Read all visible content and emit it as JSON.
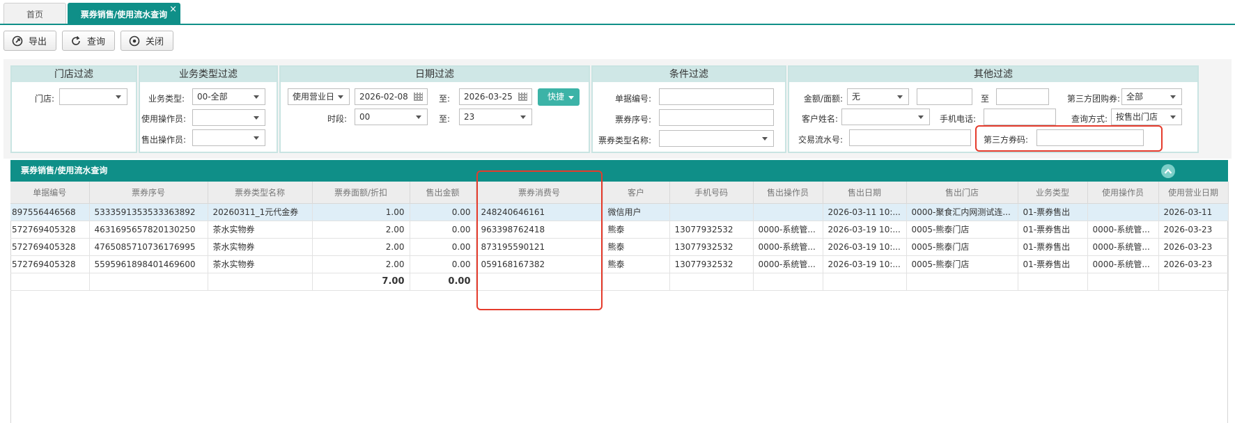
{
  "tabs": {
    "home": "首页",
    "active": "票券销售/使用流水查询",
    "close": "×"
  },
  "toolbar": {
    "export": "导出",
    "query": "查询",
    "close": "关闭"
  },
  "filters": {
    "store": {
      "title": "门店过滤",
      "store_label": "门店:",
      "store_value": ""
    },
    "business": {
      "title": "业务类型过滤",
      "type_label": "业务类型:",
      "type_value": "00-全部",
      "use_operator_label": "使用操作员:",
      "use_operator_value": "",
      "sell_operator_label": "售出操作员:",
      "sell_operator_value": ""
    },
    "date": {
      "title": "日期过滤",
      "date_type_value": "使用营业日",
      "start_date": "2026-02-08",
      "to_label1": "至:",
      "end_date": "2026-03-25",
      "quick": "快捷",
      "period_label": "时段:",
      "period_start": "00",
      "to_label2": "至:",
      "period_end": "23"
    },
    "condition": {
      "title": "条件过滤",
      "bill_no_label": "单据编号:",
      "ticket_seq_label": "票券序号:",
      "ticket_type_name_label": "票券类型名称:"
    },
    "other": {
      "title": "其他过滤",
      "amount_label": "金额/面额:",
      "amount_mode": "无",
      "to_label": "至",
      "third_group_label": "第三方团购券:",
      "third_group_value": "全部",
      "customer_label": "客户姓名:",
      "phone_label": "手机电话:",
      "query_mode_label": "查询方式:",
      "query_mode_value": "按售出门店",
      "txn_no_label": "交易流水号:",
      "third_code_label": "第三方券码:"
    }
  },
  "grid": {
    "title": "票券销售/使用流水查询",
    "columns": [
      "单据编号",
      "票券序号",
      "票券类型名称",
      "票券面额/折扣",
      "售出金额",
      "票券消费号",
      "客户",
      "手机号码",
      "售出操作员",
      "售出日期",
      "售出门店",
      "业务类型",
      "使用操作员",
      "使用营业日期"
    ],
    "rows": [
      [
        "897556446568",
        "5333591353533363892",
        "20260311_1元代金券",
        "1.00",
        "0.00",
        "248240646161",
        "微信用户",
        "",
        "",
        "2026-03-11 10:...",
        "0000-聚食汇内网测试连...",
        "01-票券售出",
        "",
        "2026-03-11"
      ],
      [
        "572769405328",
        "4631695657820130250",
        "茶水实物券",
        "2.00",
        "0.00",
        "963398762418",
        "熊泰",
        "13077932532",
        "0000-系统管...",
        "2026-03-19 10:...",
        "0005-熊泰门店",
        "01-票券售出",
        "0000-系统管...",
        "2026-03-23"
      ],
      [
        "572769405328",
        "4765085710736176995",
        "茶水实物券",
        "2.00",
        "0.00",
        "873195590121",
        "熊泰",
        "13077932532",
        "0000-系统管...",
        "2026-03-19 10:...",
        "0005-熊泰门店",
        "01-票券售出",
        "0000-系统管...",
        "2026-03-23"
      ],
      [
        "572769405328",
        "5595961898401469600",
        "茶水实物券",
        "2.00",
        "0.00",
        "059168167382",
        "熊泰",
        "13077932532",
        "0000-系统管...",
        "2026-03-19 10:...",
        "0005-熊泰门店",
        "01-票券售出",
        "0000-系统管...",
        "2026-03-23"
      ]
    ],
    "totals": {
      "face_value": "7.00",
      "sold_amount": "0.00"
    }
  }
}
